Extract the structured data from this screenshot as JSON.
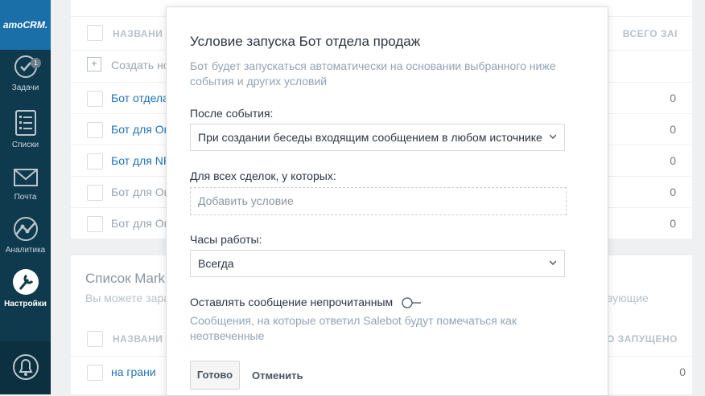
{
  "sidebar": {
    "logo": "amoCRM.",
    "items": [
      {
        "label": "Задачи",
        "badge": "1"
      },
      {
        "label": "Списки"
      },
      {
        "label": "Почта"
      },
      {
        "label": "Аналитика"
      },
      {
        "label": "Настройки"
      }
    ]
  },
  "background": {
    "table1": {
      "header_name": "НАЗВАНИ",
      "header_right": "ВСЕГО ЗАІ",
      "create_label": "Создать но",
      "rows": [
        {
          "name": "Бот отдела",
          "count": "0"
        },
        {
          "name": "Бот для Он",
          "count": "0"
        },
        {
          "name": "Бот для NP",
          "count": "0"
        },
        {
          "name": "Бот для Он",
          "count": "0"
        },
        {
          "name": "Бот для Он",
          "count": "0"
        }
      ]
    },
    "section2": {
      "title": "Список Mark",
      "subtitle_left": "Вы можете зара",
      "subtitle_right": "вующие",
      "header_name": "НАЗВАНИ",
      "header_right": "О ЗАПУЩЕНО",
      "rows": [
        {
          "name": "на грани",
          "count": "0"
        }
      ]
    }
  },
  "modal": {
    "title": "Условие запуска Бот отдела продаж",
    "description": "Бот будет запускаться автоматически на основании выбранного ниже события и других условий",
    "event_label": "После события:",
    "event_value": "При создании беседы входящим сообщением в любом источнике",
    "deals_label": "Для всех сделок, у которых:",
    "add_condition": "Добавить условие",
    "hours_label": "Часы работы:",
    "hours_value": "Всегда",
    "unread_label": "Оставлять сообщение непрочитанным",
    "unread_toggle_on": false,
    "unread_hint": "Сообщения, на которые ответил Salebot будут помечаться как неотвеченные",
    "done_button": "Готово",
    "cancel_button": "Отменить"
  }
}
